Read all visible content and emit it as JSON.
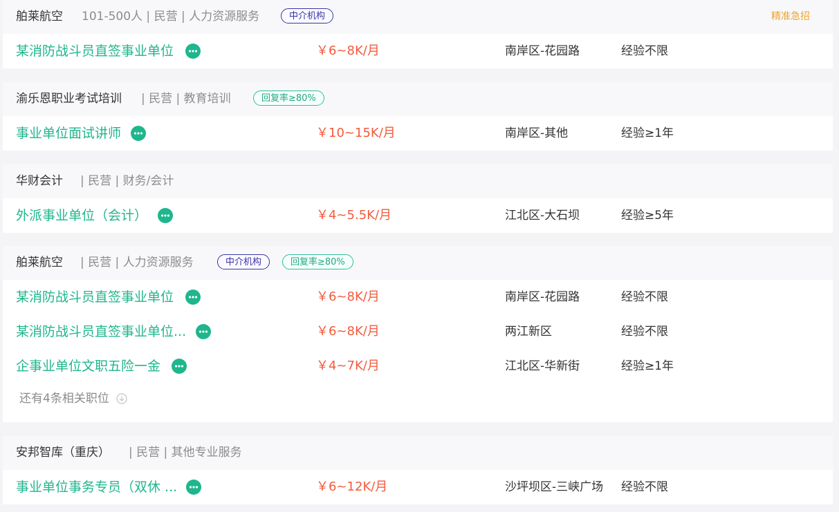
{
  "icons": {
    "chat": "chat-bubble-icon",
    "expand": "circle-down-arrow-icon"
  },
  "colors": {
    "job_title": "#1fb68d",
    "salary": "#f25a3c",
    "tag_agent": "#3b33a6",
    "tag_reply": "#2dbf98",
    "urgent": "#f0a32b",
    "meta": "#8c8c8c"
  },
  "cards": [
    {
      "company": "舶莱航空",
      "meta": "101-500人 | 民营 | 人力资源服务",
      "tags": [
        "中介机构"
      ],
      "urgent": "精准急招",
      "jobs": [
        {
          "title": "某消防战斗员直签事业单位",
          "salary": "￥6~8K/月",
          "location": "南岸区-花园路",
          "experience": "经验不限"
        }
      ]
    },
    {
      "company": "渝乐恩职业考试培训",
      "meta": "| 民营 | 教育培训",
      "tags": [
        "回复率≥80%"
      ],
      "jobs": [
        {
          "title": "事业单位面试讲师",
          "salary": "￥10~15K/月",
          "location": "南岸区-其他",
          "experience": "经验≥1年"
        }
      ]
    },
    {
      "company": "华财会计",
      "meta": "| 民营 | 财务/会计",
      "tags": [],
      "jobs": [
        {
          "title": "外派事业单位（会计）",
          "salary": "￥4~5.5K/月",
          "location": "江北区-大石坝",
          "experience": "经验≥5年"
        }
      ]
    },
    {
      "company": "舶莱航空",
      "meta": "| 民营 | 人力资源服务",
      "tags": [
        "中介机构",
        "回复率≥80%"
      ],
      "jobs": [
        {
          "title": "某消防战斗员直签事业单位",
          "salary": "￥6~8K/月",
          "location": "南岸区-花园路",
          "experience": "经验不限"
        },
        {
          "title": "某消防战斗员直签事业单位...",
          "salary": "￥6~8K/月",
          "location": "两江新区",
          "experience": "经验不限"
        },
        {
          "title": "企事业单位文职五险一金",
          "salary": "￥4~7K/月",
          "location": "江北区-华新街",
          "experience": "经验≥1年"
        }
      ],
      "more": "还有4条相关职位"
    },
    {
      "company": "安邦智库（重庆）",
      "meta": "| 民营 | 其他专业服务",
      "tags": [],
      "jobs": [
        {
          "title": "事业单位事务专员（双休 ...",
          "salary": "￥6~12K/月",
          "location": "沙坪坝区-三峡广场",
          "experience": "经验不限"
        }
      ]
    }
  ]
}
